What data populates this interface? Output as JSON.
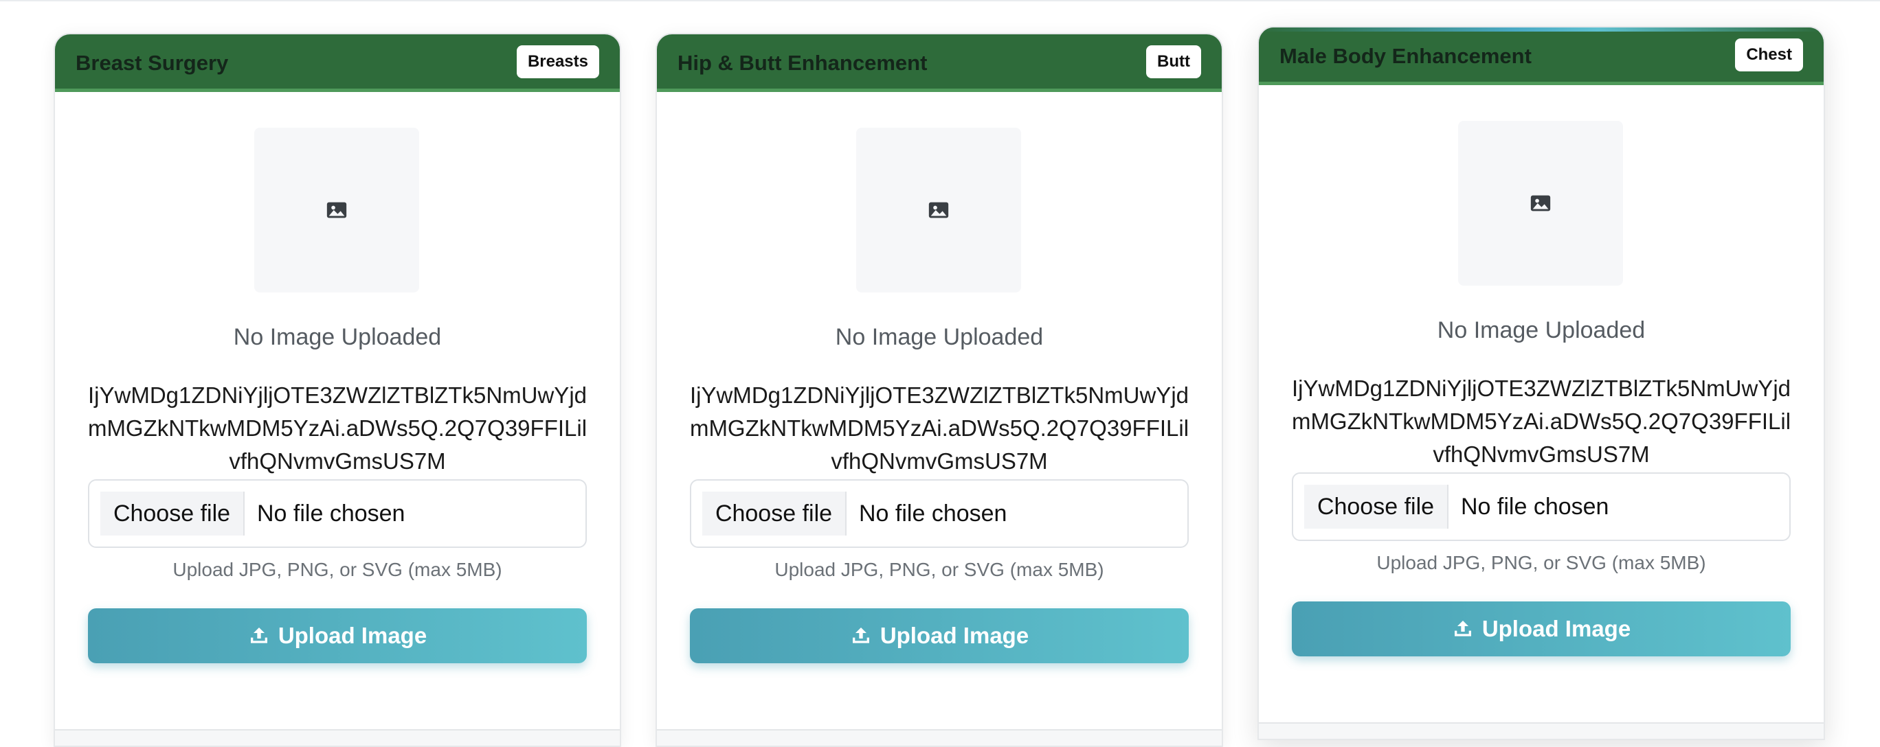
{
  "cards": [
    {
      "title": "Breast Surgery",
      "badge": "Breasts",
      "preview_text": "No Image Uploaded",
      "token": "IjYwMDg1ZDNiYjljOTE3ZWZlZTBlZTk5NmUwYjdmMGZkNTkwMDM5YzAi.aDWs5Q.2Q7Q39FFILilvfhQNvmvGmsUS7M",
      "file_button": "Choose file",
      "file_status": "No file chosen",
      "hint": "Upload JPG, PNG, or SVG (max 5MB)",
      "upload_label": "Upload Image"
    },
    {
      "title": "Hip & Butt Enhancement",
      "badge": "Butt",
      "preview_text": "No Image Uploaded",
      "token": "IjYwMDg1ZDNiYjljOTE3ZWZlZTBlZTk5NmUwYjdmMGZkNTkwMDM5YzAi.aDWs5Q.2Q7Q39FFILilvfhQNvmvGmsUS7M",
      "file_button": "Choose file",
      "file_status": "No file chosen",
      "hint": "Upload JPG, PNG, or SVG (max 5MB)",
      "upload_label": "Upload Image"
    },
    {
      "title": "Male Body Enhancement",
      "badge": "Chest",
      "preview_text": "No Image Uploaded",
      "token": "IjYwMDg1ZDNiYjljOTE3ZWZlZTBlZTk5NmUwYjdmMGZkNTkwMDM5YzAi.aDWs5Q.2Q7Q39FFILilvfhQNvmvGmsUS7M",
      "file_button": "Choose file",
      "file_status": "No file chosen",
      "hint": "Upload JPG, PNG, or SVG (max 5MB)",
      "upload_label": "Upload Image"
    }
  ],
  "icons": {
    "preview": "image-icon",
    "upload": "upload-icon"
  },
  "colors": {
    "header": "#2e6b3a",
    "button_start": "#4aa0b4",
    "button_end": "#5fc1cd"
  }
}
